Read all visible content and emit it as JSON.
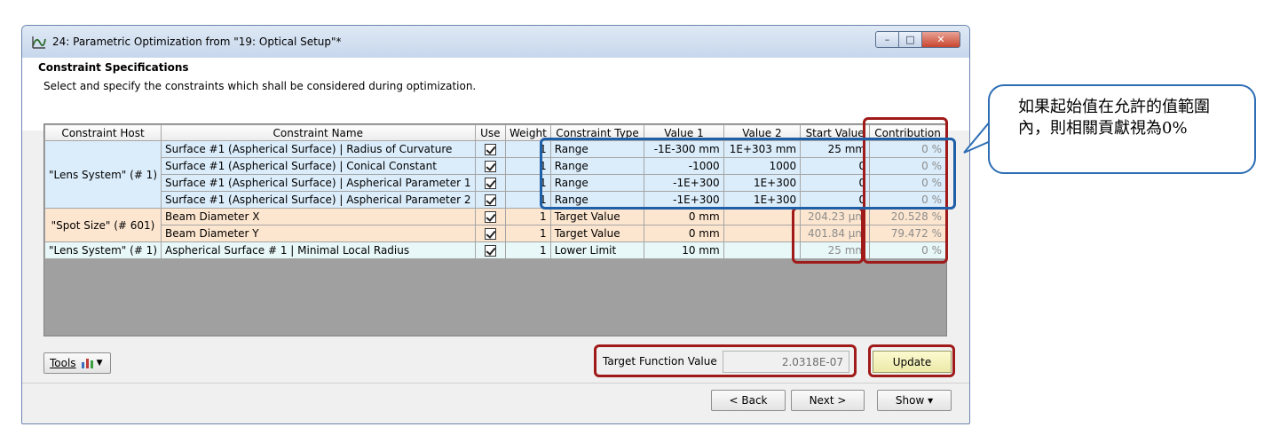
{
  "window": {
    "title": "24: Parametric Optimization from \"19: Optical Setup\"*",
    "minimize": "–",
    "maximize": "□",
    "close": "✕"
  },
  "section": {
    "title": "Constraint Specifications",
    "description": "Select and specify the constraints which shall be considered during optimization."
  },
  "table": {
    "headers": [
      "Constraint Host",
      "Constraint Name",
      "Use",
      "Weight",
      "Constraint Type",
      "Value 1",
      "Value 2",
      "Start Value",
      "Contribution"
    ],
    "groups": [
      {
        "host": "\"Lens System\" (# 1)",
        "style": "blue",
        "rows": [
          {
            "name": "Surface #1 (Aspherical Surface) | Radius of Curvature",
            "use": true,
            "weight": "1",
            "type": "Range",
            "v1": "-1E-300 mm",
            "v2": "1E+303 mm",
            "start": "25 mm",
            "contribution": "0 %"
          },
          {
            "name": "Surface #1 (Aspherical Surface) | Conical Constant",
            "use": true,
            "weight": "1",
            "type": "Range",
            "v1": "-1000",
            "v2": "1000",
            "start": "0",
            "contribution": "0 %"
          },
          {
            "name": "Surface #1 (Aspherical Surface) | Aspherical Parameter 1",
            "use": true,
            "weight": "1",
            "type": "Range",
            "v1": "-1E+300",
            "v2": "1E+300",
            "start": "0",
            "contribution": "0 %"
          },
          {
            "name": "Surface #1 (Aspherical Surface) | Aspherical Parameter 2",
            "use": true,
            "weight": "1",
            "type": "Range",
            "v1": "-1E+300",
            "v2": "1E+300",
            "start": "0",
            "contribution": "0 %"
          }
        ]
      },
      {
        "host": "\"Spot Size\" (# 601)",
        "style": "peach",
        "rows": [
          {
            "name": "Beam Diameter X",
            "use": true,
            "weight": "1",
            "type": "Target Value",
            "v1": "0 mm",
            "v2": "",
            "start": "204.23 µm",
            "contribution": "20.528 %"
          },
          {
            "name": "Beam Diameter Y",
            "use": true,
            "weight": "1",
            "type": "Target Value",
            "v1": "0 mm",
            "v2": "",
            "start": "401.84 µm",
            "contribution": "79.472 %"
          }
        ]
      },
      {
        "host": "\"Lens System\" (# 1)",
        "style": "mint",
        "rows": [
          {
            "name": "Aspherical Surface # 1 | Minimal Local Radius",
            "use": true,
            "weight": "1",
            "type": "Lower Limit",
            "v1": "10 mm",
            "v2": "",
            "start": "25 mm",
            "contribution": "0 %"
          }
        ]
      }
    ]
  },
  "tools": {
    "label": "Tools"
  },
  "target_function": {
    "label": "Target Function Value",
    "value": "2.0318E-07"
  },
  "buttons": {
    "update": "Update",
    "back": "< Back",
    "next": "Next >",
    "show": "Show ▾"
  },
  "annotation": {
    "text": "如果起始值在允許的值範圍內，則相關貢獻視為0%"
  },
  "colors": {
    "red_marker": "#a01a1a",
    "blue_marker": "#1f5fa8",
    "update_button": "#f4f1bc"
  }
}
